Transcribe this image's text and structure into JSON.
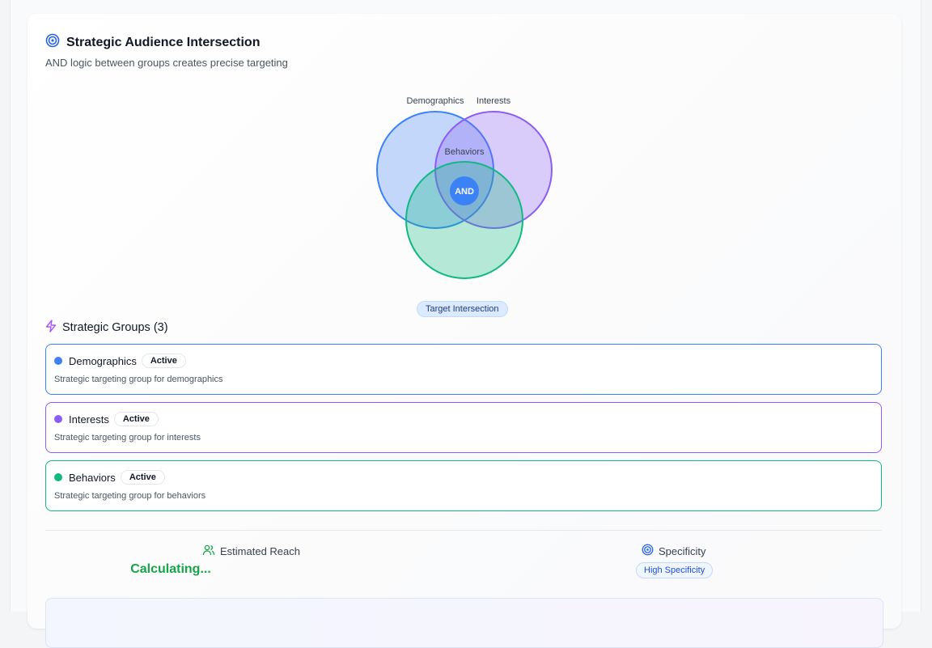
{
  "header": {
    "title": "Strategic Audience Intersection",
    "subtitle": "AND logic between groups creates precise targeting"
  },
  "venn": {
    "labels": {
      "demographics": "Demographics",
      "interests": "Interests",
      "behaviors": "Behaviors"
    },
    "center_label": "AND",
    "target_label": "Target Intersection",
    "colors": {
      "demographics": "#3b82f6",
      "interests": "#8b5cf6",
      "behaviors": "#10b981"
    }
  },
  "groups": {
    "heading": "Strategic Groups (3)",
    "items": [
      {
        "name": "Demographics",
        "status": "Active",
        "description": "Strategic targeting group for demographics",
        "color": "#3b82f6"
      },
      {
        "name": "Interests",
        "status": "Active",
        "description": "Strategic targeting group for interests",
        "color": "#8b5cf6"
      },
      {
        "name": "Behaviors",
        "status": "Active",
        "description": "Strategic targeting group for behaviors",
        "color": "#10b981"
      }
    ]
  },
  "stats": {
    "reach_label": "Estimated Reach",
    "reach_value": "Calculating...",
    "specificity_label": "Specificity",
    "specificity_value": "High Specificity"
  },
  "icons": {
    "title": "target-icon",
    "groups": "zap-icon",
    "reach": "users-icon",
    "specificity": "target-icon"
  }
}
